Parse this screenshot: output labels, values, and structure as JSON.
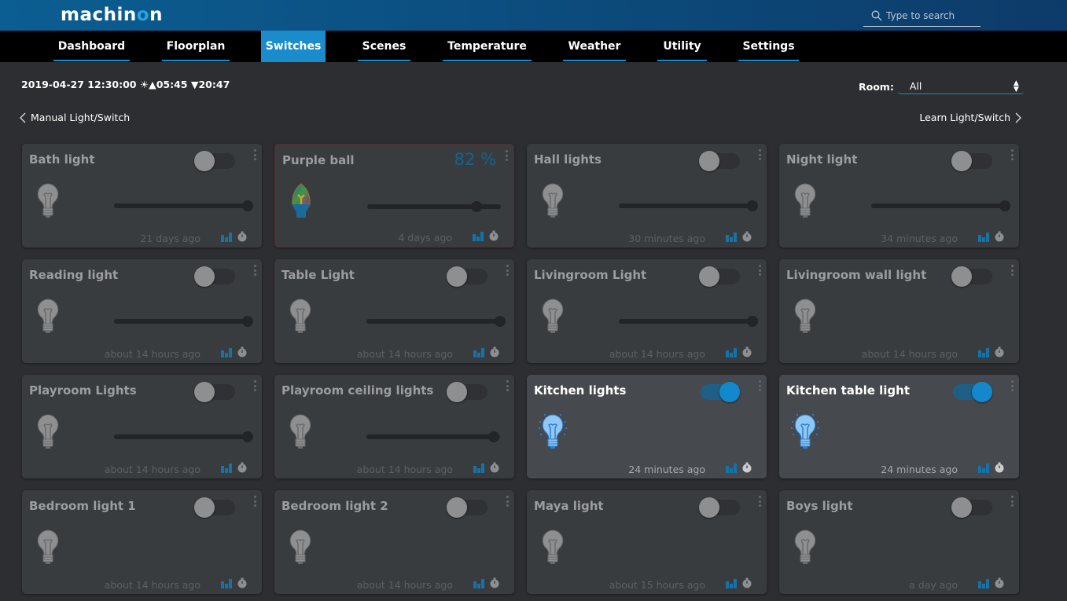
{
  "header": {
    "logo": "machinon",
    "search_placeholder": "Type to search"
  },
  "nav": {
    "tabs": [
      {
        "label": "Dashboard",
        "active": false
      },
      {
        "label": "Floorplan",
        "active": false
      },
      {
        "label": "Switches",
        "active": true
      },
      {
        "label": "Scenes",
        "active": false
      },
      {
        "label": "Temperature",
        "active": false
      },
      {
        "label": "Weather",
        "active": false
      },
      {
        "label": "Utility",
        "active": false
      },
      {
        "label": "Settings",
        "active": false
      }
    ]
  },
  "info": {
    "datetime": "2019-04-27 12:30:00",
    "sunrise": "05:45",
    "sunset": "20:47"
  },
  "room": {
    "label": "Room:",
    "value": "All"
  },
  "links": {
    "prev": "Manual Light/Switch",
    "next": "Learn Light/Switch"
  },
  "colors": {
    "accent": "#1a8ccc",
    "on_bulb": "#8fc8f5",
    "off_bulb": "#8e8f91"
  },
  "devices": [
    {
      "name": "Bath light",
      "on": false,
      "level": 100,
      "time": "21 days ago"
    },
    {
      "name": "Purple ball",
      "on": false,
      "level": 82,
      "percent": "82 %",
      "rgb": true,
      "time": "4 days ago"
    },
    {
      "name": "Hall lights",
      "on": false,
      "level": 100,
      "time": "30 minutes ago"
    },
    {
      "name": "Night light",
      "on": false,
      "level": 100,
      "time": "34 minutes ago"
    },
    {
      "name": "Reading light",
      "on": false,
      "level": 100,
      "time": "about 14 hours ago"
    },
    {
      "name": "Table Light",
      "on": false,
      "level": 100,
      "time": "about 14 hours ago"
    },
    {
      "name": "Livingroom Light",
      "on": false,
      "level": 100,
      "time": "about 14 hours ago"
    },
    {
      "name": "Livingroom wall light",
      "on": false,
      "time": "about 14 hours ago"
    },
    {
      "name": "Playroom Lights",
      "on": false,
      "level": 100,
      "time": "about 14 hours ago"
    },
    {
      "name": "Playroom ceiling lights",
      "on": false,
      "level": 95,
      "time": "about 14 hours ago"
    },
    {
      "name": "Kitchen lights",
      "on": true,
      "time": "24 minutes ago"
    },
    {
      "name": "Kitchen table light",
      "on": true,
      "time": "24 minutes ago"
    },
    {
      "name": "Bedroom light 1",
      "on": false,
      "time": "about 14 hours ago"
    },
    {
      "name": "Bedroom light 2",
      "on": false,
      "time": "about 14 hours ago"
    },
    {
      "name": "Maya light",
      "on": false,
      "time": "about 15 hours ago"
    },
    {
      "name": "Boys light",
      "on": false,
      "time": "a day ago"
    }
  ]
}
